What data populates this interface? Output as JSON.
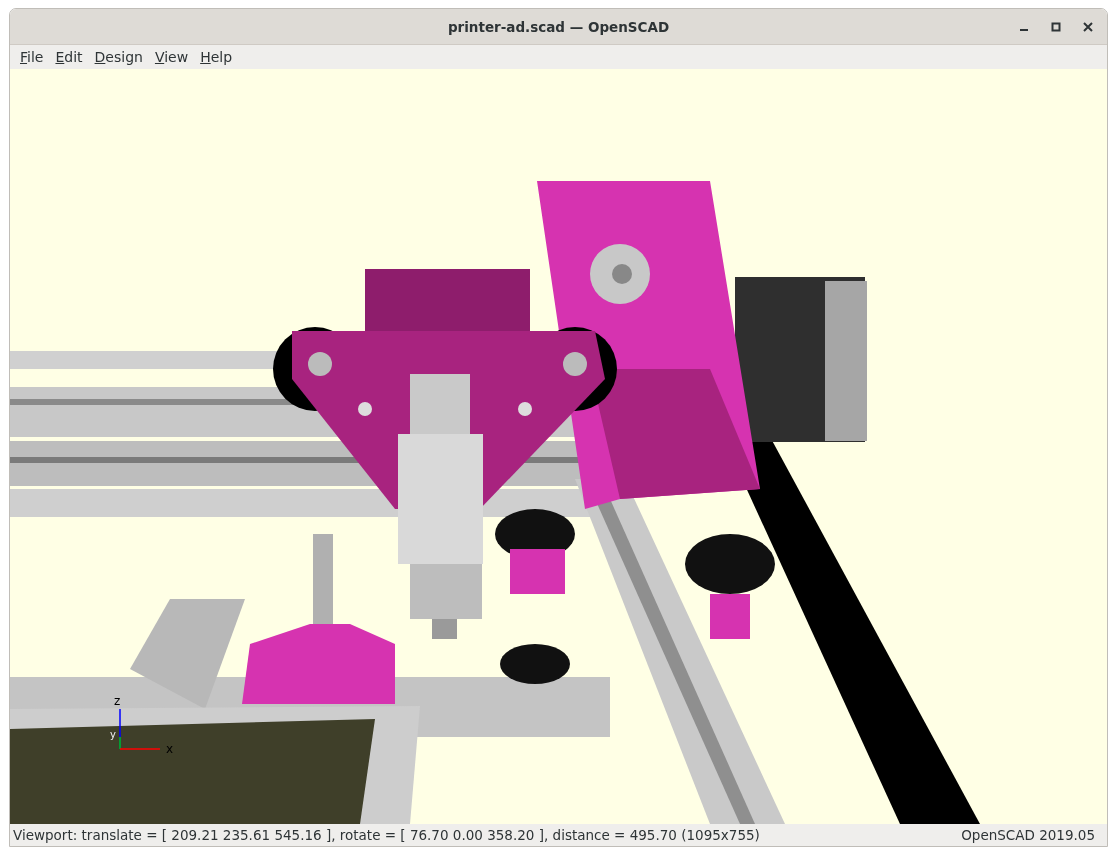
{
  "window": {
    "title": "printer-ad.scad — OpenSCAD"
  },
  "menu": [
    "File",
    "Edit",
    "Design",
    "View",
    "Help"
  ],
  "viewport": {
    "axis_labels": [
      "z",
      "y",
      "x"
    ]
  },
  "status_bar": {
    "viewport_info": "Viewport: translate = [ 209.21 235.61 545.16 ], rotate = [ 76.70 0.00 358.20 ], distance = 495.70 (1095x755)",
    "version": "OpenSCAD 2019.05"
  }
}
